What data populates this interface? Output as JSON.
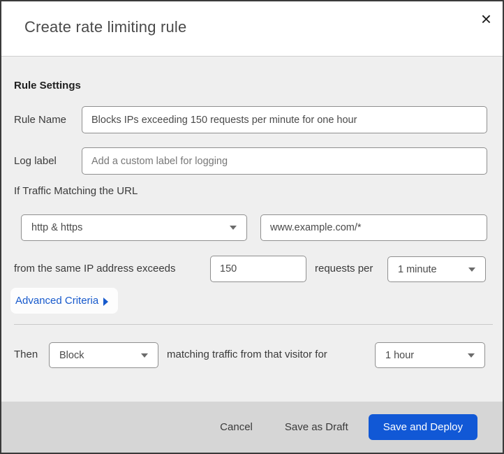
{
  "window": {
    "top_accent": {
      "navy": "#15202d",
      "red": "#541a18"
    }
  },
  "modal": {
    "title": "Create rate limiting rule",
    "close_icon": "×",
    "body": {
      "section_heading": "Rule Settings",
      "rule_name": {
        "label": "Rule Name",
        "value": "Blocks IPs exceeding 150 requests per minute for one hour"
      },
      "log_label": {
        "label": "Log label",
        "placeholder": "Add a custom label for logging"
      },
      "traffic": {
        "heading": "If Traffic Matching the URL",
        "protocol": "http & https",
        "url": "www.example.com/*"
      },
      "threshold": {
        "text_before": "from the same IP address exceeds",
        "requests": "150",
        "text_between": "requests per",
        "period": "1 minute"
      },
      "advanced_link": "Advanced Criteria",
      "action": {
        "text_before": "Then",
        "action": "Block",
        "text_between": "matching traffic from that visitor for",
        "duration": "1 hour"
      }
    },
    "footer": {
      "cancel": "Cancel",
      "save_draft": "Save as Draft",
      "save_deploy": "Save and Deploy"
    },
    "colors": {
      "primary_blue": "#1158d6",
      "link_blue": "#1659cc",
      "body_bg": "#efefef",
      "footer_bg": "#d6d6d6"
    }
  }
}
